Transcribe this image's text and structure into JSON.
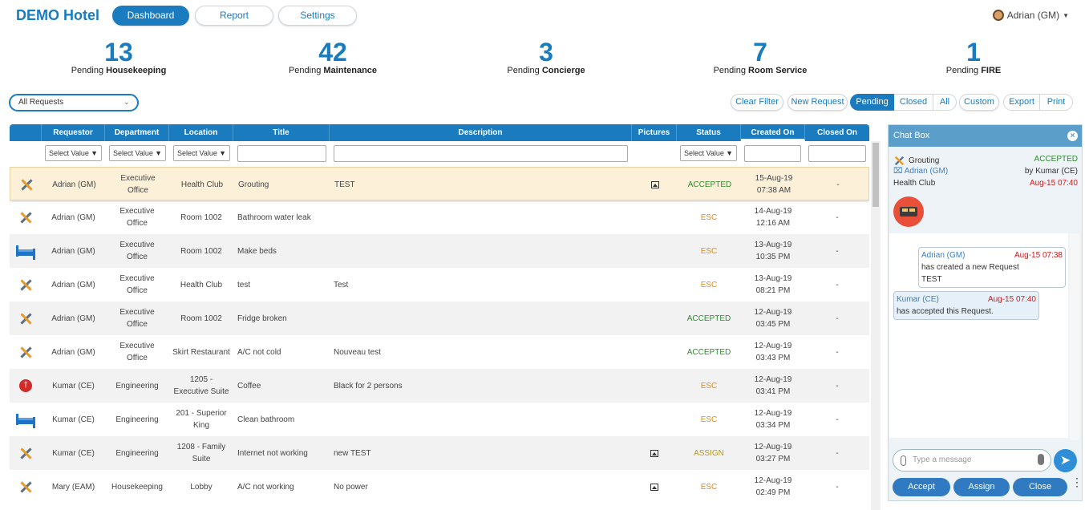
{
  "app": {
    "brand": "DEMO Hotel",
    "user": "Adrian (GM)"
  },
  "nav": {
    "dashboard": "Dashboard",
    "report": "Report",
    "settings": "Settings"
  },
  "stats": [
    {
      "num": "13",
      "prefix": "Pending",
      "name": "Housekeeping"
    },
    {
      "num": "42",
      "prefix": "Pending",
      "name": "Maintenance"
    },
    {
      "num": "3",
      "prefix": "Pending",
      "name": "Concierge"
    },
    {
      "num": "7",
      "prefix": "Pending",
      "name": "Room Service"
    },
    {
      "num": "1",
      "prefix": "Pending",
      "name": "FIRE"
    }
  ],
  "filter": {
    "request_select": "All Requests"
  },
  "actions": {
    "clear_filter": "Clear Filter",
    "new_request": "New Request",
    "pending": "Pending",
    "closed": "Closed",
    "all": "All",
    "custom": "Custom",
    "export": "Export",
    "print": "Print"
  },
  "table": {
    "headers": [
      "Requestor",
      "Department",
      "Location",
      "Title",
      "Description",
      "Pictures",
      "Status",
      "Created On",
      "Closed On"
    ],
    "select_value": "Select Value",
    "rows": [
      {
        "icon": "tools-icon",
        "requestor": "Adrian (GM)",
        "department": "Executive Office",
        "location": "Health Club",
        "title": "Grouting",
        "description": "TEST",
        "picture": true,
        "status": "ACCEPTED",
        "created_date": "15-Aug-19",
        "created_time": "07:38 AM",
        "closed": "-"
      },
      {
        "icon": "tools-icon",
        "requestor": "Adrian (GM)",
        "department": "Executive Office",
        "location": "Room 1002",
        "title": "Bathroom water leak",
        "description": "",
        "picture": false,
        "status": "ESC",
        "created_date": "14-Aug-19",
        "created_time": "12:16 AM",
        "closed": "-"
      },
      {
        "icon": "bed-icon",
        "requestor": "Adrian (GM)",
        "department": "Executive Office",
        "location": "Room 1002",
        "title": "Make beds",
        "description": "",
        "picture": false,
        "status": "ESC",
        "created_date": "13-Aug-19",
        "created_time": "10:35 PM",
        "closed": "-"
      },
      {
        "icon": "tools-icon",
        "requestor": "Adrian (GM)",
        "department": "Executive Office",
        "location": "Health Club",
        "title": "test",
        "description": "Test",
        "picture": false,
        "status": "ESC",
        "created_date": "13-Aug-19",
        "created_time": "08:21 PM",
        "closed": "-"
      },
      {
        "icon": "tools-icon",
        "requestor": "Adrian (GM)",
        "department": "Executive Office",
        "location": "Room 1002",
        "title": "Fridge broken",
        "description": "",
        "picture": false,
        "status": "ACCEPTED",
        "created_date": "12-Aug-19",
        "created_time": "03:45 PM",
        "closed": "-"
      },
      {
        "icon": "tools-icon",
        "requestor": "Adrian (GM)",
        "department": "Executive Office",
        "location": "Skirt Restaurant",
        "title": "A/C not cold",
        "description": "Nouveau test",
        "picture": false,
        "status": "ACCEPTED",
        "created_date": "12-Aug-19",
        "created_time": "03:43 PM",
        "closed": "-"
      },
      {
        "icon": "food-icon",
        "requestor": "Kumar (CE)",
        "department": "Engineering",
        "location": "1205 - Executive Suite",
        "title": "Coffee",
        "description": "Black for 2 persons",
        "picture": false,
        "status": "ESC",
        "created_date": "12-Aug-19",
        "created_time": "03:41 PM",
        "closed": "-"
      },
      {
        "icon": "bed-icon",
        "requestor": "Kumar (CE)",
        "department": "Engineering",
        "location": "201 - Superior King",
        "title": "Clean bathroom",
        "description": "",
        "picture": false,
        "status": "ESC",
        "created_date": "12-Aug-19",
        "created_time": "03:34 PM",
        "closed": "-"
      },
      {
        "icon": "tools-icon",
        "requestor": "Kumar (CE)",
        "department": "Engineering",
        "location": "1208 - Family Suite",
        "title": "Internet not working",
        "description": "new TEST",
        "picture": true,
        "status": "ASSIGN",
        "created_date": "12-Aug-19",
        "created_time": "03:27 PM",
        "closed": "-"
      },
      {
        "icon": "tools-icon",
        "requestor": "Mary (EAM)",
        "department": "Housekeeping",
        "location": "Lobby",
        "title": "A/C not working",
        "description": "No power",
        "picture": true,
        "status": "ESC",
        "created_date": "12-Aug-19",
        "created_time": "02:49 PM",
        "closed": "-"
      }
    ]
  },
  "chat": {
    "title": "Chat Box",
    "req_title": "Grouting",
    "req_status": "ACCEPTED",
    "req_owner": "Adrian (GM)",
    "req_by": "by Kumar (CE)",
    "req_location": "Health Club",
    "req_time": "Aug-15 07:40",
    "messages": [
      {
        "author": "Adrian (GM)",
        "time": "Aug-15 07:38",
        "line1": "has created a new Request",
        "line2": "TEST"
      },
      {
        "author": "Kumar (CE)",
        "time": "Aug-15 07:40",
        "line1": "has accepted this Request.",
        "line2": ""
      }
    ],
    "input_placeholder": "Type a message",
    "accept": "Accept",
    "assign": "Assign",
    "close": "Close"
  },
  "colors": {
    "primary": "#1a7bbf",
    "accepted": "#2e8b2e",
    "esc": "#e08a1e",
    "assign": "#b59a1a",
    "time_red": "#d11b1b"
  }
}
